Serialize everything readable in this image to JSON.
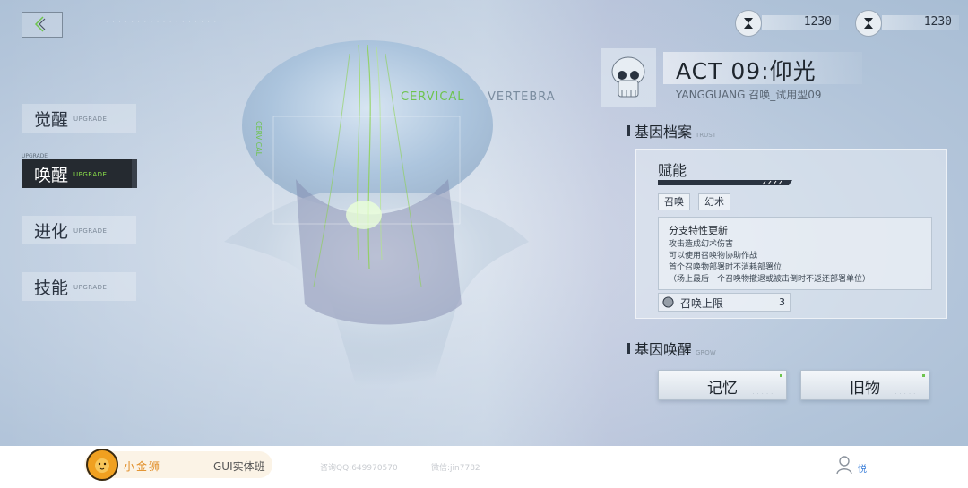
{
  "nav": {
    "deco_text": "· · · · · · · · · · · · · · · · · ·"
  },
  "resources": [
    {
      "icon": "hourglass-icon",
      "value": "1230"
    },
    {
      "icon": "hourglass-icon",
      "value": "1230"
    }
  ],
  "sidebar": {
    "tag": "UPGRADE",
    "items": [
      {
        "cn": "觉醒",
        "en": "UPGRADE",
        "active": false
      },
      {
        "cn": "唤醒",
        "en": "UPGRADE",
        "active": true
      },
      {
        "cn": "进化",
        "en": "UPGRADE",
        "active": false
      },
      {
        "cn": "技能",
        "en": "UPGRADE",
        "active": false
      }
    ]
  },
  "scan": {
    "label_a": "CERVICAL",
    "label_b": "VERTEBRA",
    "label_vertical": "CERVICAL"
  },
  "character": {
    "title": "ACT 09:仰光",
    "subtitle": "YANGGUANG 召唤_试用型09"
  },
  "gene_file": {
    "title": "基因档案",
    "en": "TRUST",
    "talent": {
      "title": "赋能",
      "tags": [
        "召唤",
        "幻术"
      ],
      "desc_title": "分支特性更新",
      "desc_lines": [
        "攻击造成幻术伤害",
        "可以使用召唤物协助作战",
        "首个召唤物部署时不消耗部署位",
        "（场上最后一个召唤物撤退或被击倒时不返还部署单位）"
      ],
      "limit_label": "召唤上限",
      "limit_value": "3"
    }
  },
  "gene_awaken": {
    "title": "基因唤醒",
    "en": "GROW",
    "buttons": [
      {
        "label": "记忆",
        "sub": "· · · · ·"
      },
      {
        "label": "旧物",
        "sub": "· · · · ·"
      }
    ]
  },
  "footer": {
    "brand_name": "小金狮",
    "brand_class": "GUI实体班",
    "qq": "咨询QQ:649970570",
    "wechat": "微信:jin7782",
    "user_name": "悦"
  },
  "colors": {
    "accent_green": "#6ec44e",
    "dark": "#252a30",
    "brand_orange": "#e08a20"
  }
}
